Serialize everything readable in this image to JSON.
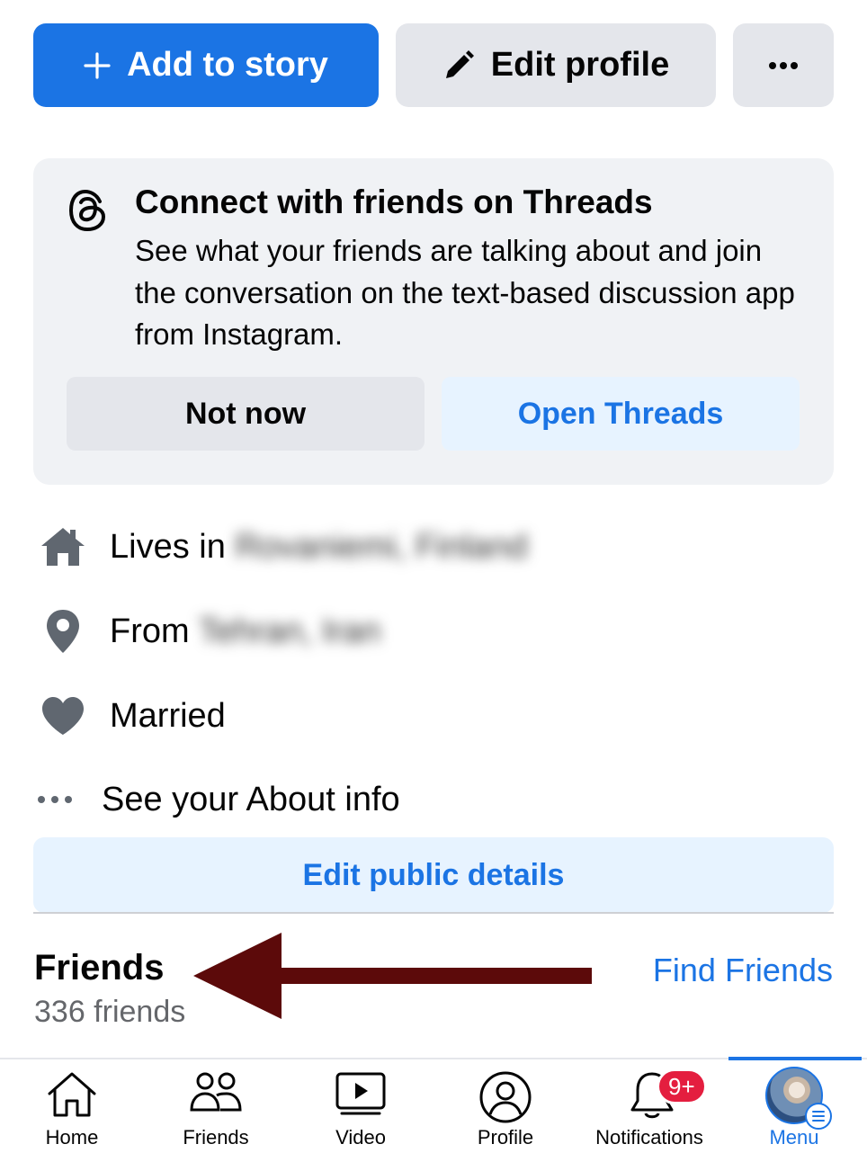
{
  "header": {
    "add_story_label": "Add to story",
    "edit_profile_label": "Edit profile"
  },
  "threads": {
    "title": "Connect with friends on Threads",
    "body": "See what your friends are talking about and join the conversation on the text-based discussion app from Instagram.",
    "not_now_label": "Not now",
    "open_label": "Open Threads"
  },
  "about": {
    "lives_prefix": "Lives in",
    "lives_value": "Rovaniemi, Finland",
    "from_prefix": "From",
    "from_value": "Tehran, Iran",
    "relationship": "Married",
    "see_about": "See your About info",
    "edit_public_label": "Edit public details"
  },
  "friends": {
    "title": "Friends",
    "count": "336 friends",
    "find_label": "Find Friends"
  },
  "tabbar": {
    "home": "Home",
    "friends": "Friends",
    "video": "Video",
    "profile": "Profile",
    "notifications": "Notifications",
    "notifications_badge": "9+",
    "menu": "Menu"
  },
  "colors": {
    "accent": "#1b74e4",
    "arrow": "#5c0a0a",
    "badge": "#e41e3f"
  }
}
